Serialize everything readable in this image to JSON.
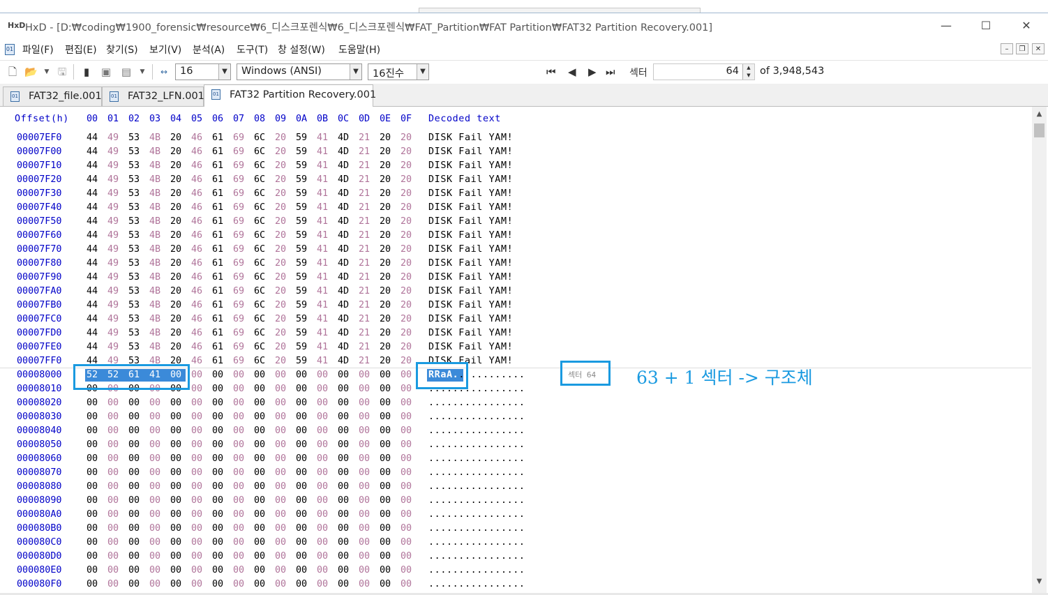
{
  "window": {
    "title": "HxD - [D:₩coding₩1900_forensic₩resource₩6_디스크포렌식₩6_디스크포렌식₩FAT_Partition₩FAT Partition₩FAT32 Partition Recovery.001]",
    "app_icon": "HxD",
    "minimize": "—",
    "maximize": "☐",
    "close": "✕"
  },
  "menu": {
    "items": [
      "파일(F)",
      "편집(E)",
      "찾기(S)",
      "보기(V)",
      "분석(A)",
      "도구(T)",
      "창 설정(W)",
      "도움말(H)"
    ],
    "mdi_minimize": "–",
    "mdi_restore": "❐",
    "mdi_close": "✕"
  },
  "toolbar": {
    "bytes_per_row": "16",
    "charset": "Windows (ANSI)",
    "offset_base": "16진수",
    "sector_label": "섹터",
    "sector_value": "64",
    "sector_total": "of 3,948,543"
  },
  "tabs": [
    {
      "label": "FAT32_file.001",
      "active": false
    },
    {
      "label": "FAT32_LFN.001",
      "active": false
    },
    {
      "label": "FAT32 Partition Recovery.001",
      "active": true
    }
  ],
  "hex": {
    "offset_header": "Offset(h)",
    "columns": [
      "00",
      "01",
      "02",
      "03",
      "04",
      "05",
      "06",
      "07",
      "08",
      "09",
      "0A",
      "0B",
      "0C",
      "0D",
      "0E",
      "0F"
    ],
    "decoded_header": "Decoded text",
    "rows": [
      {
        "offset": "00007EF0",
        "bytes": [
          "44",
          "49",
          "53",
          "4B",
          "20",
          "46",
          "61",
          "69",
          "6C",
          "20",
          "59",
          "41",
          "4D",
          "21",
          "20",
          "20"
        ],
        "text": "DISK Fail YAM!"
      },
      {
        "offset": "00007F00",
        "bytes": [
          "44",
          "49",
          "53",
          "4B",
          "20",
          "46",
          "61",
          "69",
          "6C",
          "20",
          "59",
          "41",
          "4D",
          "21",
          "20",
          "20"
        ],
        "text": "DISK Fail YAM!"
      },
      {
        "offset": "00007F10",
        "bytes": [
          "44",
          "49",
          "53",
          "4B",
          "20",
          "46",
          "61",
          "69",
          "6C",
          "20",
          "59",
          "41",
          "4D",
          "21",
          "20",
          "20"
        ],
        "text": "DISK Fail YAM!"
      },
      {
        "offset": "00007F20",
        "bytes": [
          "44",
          "49",
          "53",
          "4B",
          "20",
          "46",
          "61",
          "69",
          "6C",
          "20",
          "59",
          "41",
          "4D",
          "21",
          "20",
          "20"
        ],
        "text": "DISK Fail YAM!"
      },
      {
        "offset": "00007F30",
        "bytes": [
          "44",
          "49",
          "53",
          "4B",
          "20",
          "46",
          "61",
          "69",
          "6C",
          "20",
          "59",
          "41",
          "4D",
          "21",
          "20",
          "20"
        ],
        "text": "DISK Fail YAM!"
      },
      {
        "offset": "00007F40",
        "bytes": [
          "44",
          "49",
          "53",
          "4B",
          "20",
          "46",
          "61",
          "69",
          "6C",
          "20",
          "59",
          "41",
          "4D",
          "21",
          "20",
          "20"
        ],
        "text": "DISK Fail YAM!"
      },
      {
        "offset": "00007F50",
        "bytes": [
          "44",
          "49",
          "53",
          "4B",
          "20",
          "46",
          "61",
          "69",
          "6C",
          "20",
          "59",
          "41",
          "4D",
          "21",
          "20",
          "20"
        ],
        "text": "DISK Fail YAM!"
      },
      {
        "offset": "00007F60",
        "bytes": [
          "44",
          "49",
          "53",
          "4B",
          "20",
          "46",
          "61",
          "69",
          "6C",
          "20",
          "59",
          "41",
          "4D",
          "21",
          "20",
          "20"
        ],
        "text": "DISK Fail YAM!"
      },
      {
        "offset": "00007F70",
        "bytes": [
          "44",
          "49",
          "53",
          "4B",
          "20",
          "46",
          "61",
          "69",
          "6C",
          "20",
          "59",
          "41",
          "4D",
          "21",
          "20",
          "20"
        ],
        "text": "DISK Fail YAM!"
      },
      {
        "offset": "00007F80",
        "bytes": [
          "44",
          "49",
          "53",
          "4B",
          "20",
          "46",
          "61",
          "69",
          "6C",
          "20",
          "59",
          "41",
          "4D",
          "21",
          "20",
          "20"
        ],
        "text": "DISK Fail YAM!"
      },
      {
        "offset": "00007F90",
        "bytes": [
          "44",
          "49",
          "53",
          "4B",
          "20",
          "46",
          "61",
          "69",
          "6C",
          "20",
          "59",
          "41",
          "4D",
          "21",
          "20",
          "20"
        ],
        "text": "DISK Fail YAM!"
      },
      {
        "offset": "00007FA0",
        "bytes": [
          "44",
          "49",
          "53",
          "4B",
          "20",
          "46",
          "61",
          "69",
          "6C",
          "20",
          "59",
          "41",
          "4D",
          "21",
          "20",
          "20"
        ],
        "text": "DISK Fail YAM!"
      },
      {
        "offset": "00007FB0",
        "bytes": [
          "44",
          "49",
          "53",
          "4B",
          "20",
          "46",
          "61",
          "69",
          "6C",
          "20",
          "59",
          "41",
          "4D",
          "21",
          "20",
          "20"
        ],
        "text": "DISK Fail YAM!"
      },
      {
        "offset": "00007FC0",
        "bytes": [
          "44",
          "49",
          "53",
          "4B",
          "20",
          "46",
          "61",
          "69",
          "6C",
          "20",
          "59",
          "41",
          "4D",
          "21",
          "20",
          "20"
        ],
        "text": "DISK Fail YAM!"
      },
      {
        "offset": "00007FD0",
        "bytes": [
          "44",
          "49",
          "53",
          "4B",
          "20",
          "46",
          "61",
          "69",
          "6C",
          "20",
          "59",
          "41",
          "4D",
          "21",
          "20",
          "20"
        ],
        "text": "DISK Fail YAM!"
      },
      {
        "offset": "00007FE0",
        "bytes": [
          "44",
          "49",
          "53",
          "4B",
          "20",
          "46",
          "61",
          "69",
          "6C",
          "20",
          "59",
          "41",
          "4D",
          "21",
          "20",
          "20"
        ],
        "text": "DISK Fail YAM!"
      },
      {
        "offset": "00007FF0",
        "bytes": [
          "44",
          "49",
          "53",
          "4B",
          "20",
          "46",
          "61",
          "69",
          "6C",
          "20",
          "59",
          "41",
          "4D",
          "21",
          "20",
          "20"
        ],
        "text": "DISK Fail YAM!"
      },
      {
        "offset": "00008000",
        "bytes": [
          "52",
          "52",
          "61",
          "41",
          "00",
          "00",
          "00",
          "00",
          "00",
          "00",
          "00",
          "00",
          "00",
          "00",
          "00",
          "00"
        ],
        "text": "RRaA............"
      },
      {
        "offset": "00008010",
        "bytes": [
          "00",
          "00",
          "00",
          "00",
          "00",
          "00",
          "00",
          "00",
          "00",
          "00",
          "00",
          "00",
          "00",
          "00",
          "00",
          "00"
        ],
        "text": "................"
      },
      {
        "offset": "00008020",
        "bytes": [
          "00",
          "00",
          "00",
          "00",
          "00",
          "00",
          "00",
          "00",
          "00",
          "00",
          "00",
          "00",
          "00",
          "00",
          "00",
          "00"
        ],
        "text": "................"
      },
      {
        "offset": "00008030",
        "bytes": [
          "00",
          "00",
          "00",
          "00",
          "00",
          "00",
          "00",
          "00",
          "00",
          "00",
          "00",
          "00",
          "00",
          "00",
          "00",
          "00"
        ],
        "text": "................"
      },
      {
        "offset": "00008040",
        "bytes": [
          "00",
          "00",
          "00",
          "00",
          "00",
          "00",
          "00",
          "00",
          "00",
          "00",
          "00",
          "00",
          "00",
          "00",
          "00",
          "00"
        ],
        "text": "................"
      },
      {
        "offset": "00008050",
        "bytes": [
          "00",
          "00",
          "00",
          "00",
          "00",
          "00",
          "00",
          "00",
          "00",
          "00",
          "00",
          "00",
          "00",
          "00",
          "00",
          "00"
        ],
        "text": "................"
      },
      {
        "offset": "00008060",
        "bytes": [
          "00",
          "00",
          "00",
          "00",
          "00",
          "00",
          "00",
          "00",
          "00",
          "00",
          "00",
          "00",
          "00",
          "00",
          "00",
          "00"
        ],
        "text": "................"
      },
      {
        "offset": "00008070",
        "bytes": [
          "00",
          "00",
          "00",
          "00",
          "00",
          "00",
          "00",
          "00",
          "00",
          "00",
          "00",
          "00",
          "00",
          "00",
          "00",
          "00"
        ],
        "text": "................"
      },
      {
        "offset": "00008080",
        "bytes": [
          "00",
          "00",
          "00",
          "00",
          "00",
          "00",
          "00",
          "00",
          "00",
          "00",
          "00",
          "00",
          "00",
          "00",
          "00",
          "00"
        ],
        "text": "................"
      },
      {
        "offset": "00008090",
        "bytes": [
          "00",
          "00",
          "00",
          "00",
          "00",
          "00",
          "00",
          "00",
          "00",
          "00",
          "00",
          "00",
          "00",
          "00",
          "00",
          "00"
        ],
        "text": "................"
      },
      {
        "offset": "000080A0",
        "bytes": [
          "00",
          "00",
          "00",
          "00",
          "00",
          "00",
          "00",
          "00",
          "00",
          "00",
          "00",
          "00",
          "00",
          "00",
          "00",
          "00"
        ],
        "text": "................"
      },
      {
        "offset": "000080B0",
        "bytes": [
          "00",
          "00",
          "00",
          "00",
          "00",
          "00",
          "00",
          "00",
          "00",
          "00",
          "00",
          "00",
          "00",
          "00",
          "00",
          "00"
        ],
        "text": "................"
      },
      {
        "offset": "000080C0",
        "bytes": [
          "00",
          "00",
          "00",
          "00",
          "00",
          "00",
          "00",
          "00",
          "00",
          "00",
          "00",
          "00",
          "00",
          "00",
          "00",
          "00"
        ],
        "text": "................"
      },
      {
        "offset": "000080D0",
        "bytes": [
          "00",
          "00",
          "00",
          "00",
          "00",
          "00",
          "00",
          "00",
          "00",
          "00",
          "00",
          "00",
          "00",
          "00",
          "00",
          "00"
        ],
        "text": "................"
      },
      {
        "offset": "000080E0",
        "bytes": [
          "00",
          "00",
          "00",
          "00",
          "00",
          "00",
          "00",
          "00",
          "00",
          "00",
          "00",
          "00",
          "00",
          "00",
          "00",
          "00"
        ],
        "text": "................"
      },
      {
        "offset": "000080F0",
        "bytes": [
          "00",
          "00",
          "00",
          "00",
          "00",
          "00",
          "00",
          "00",
          "00",
          "00",
          "00",
          "00",
          "00",
          "00",
          "00",
          "00"
        ],
        "text": "................"
      }
    ],
    "sector_marker": "섹터 64"
  },
  "annotation": {
    "text": "63 + 1 섹터 -> 구조체",
    "color": "#1a9ae0"
  },
  "colors": {
    "offset_blue": "#0000c8",
    "selection": "#3b8ad9"
  }
}
